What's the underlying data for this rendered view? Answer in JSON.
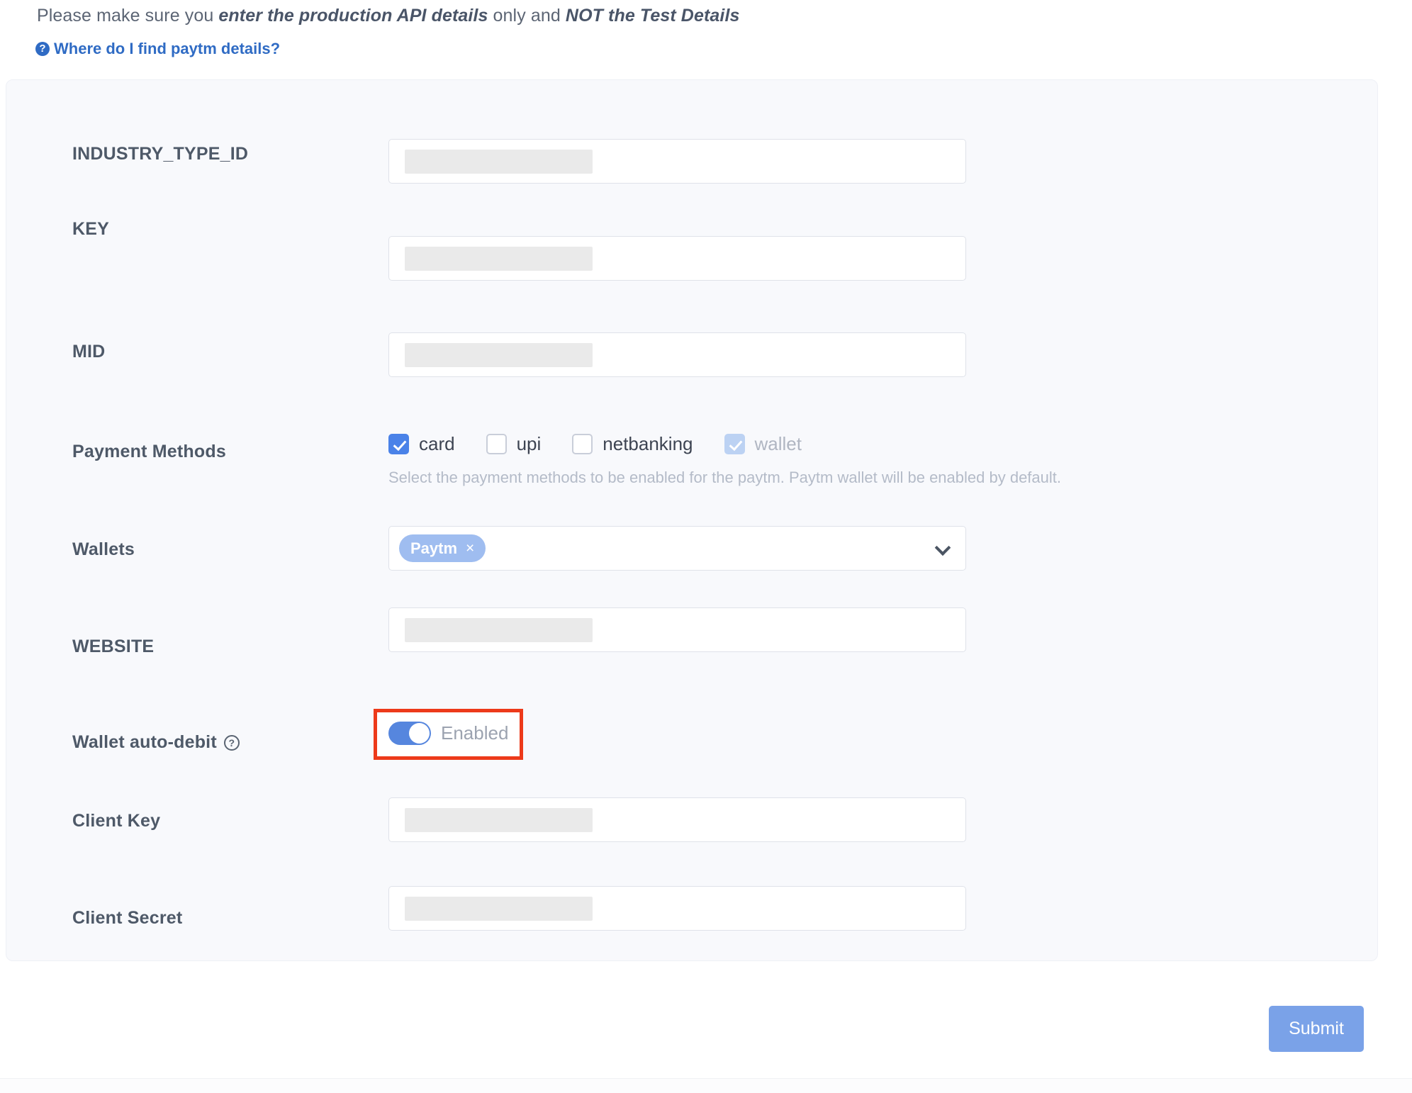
{
  "notice": {
    "part1": "Please make sure you ",
    "em1": "enter the production API details",
    "part2": " only and ",
    "em2": "NOT the Test Details"
  },
  "help_link": {
    "icon": "question-circle-icon",
    "label": "Where do I find paytm details?"
  },
  "form": {
    "fields": [
      {
        "label": "INDUSTRY_TYPE_ID",
        "value": "",
        "placeholder": ""
      },
      {
        "label": "KEY",
        "value": "",
        "placeholder": ""
      },
      {
        "label": "MID",
        "value": "",
        "placeholder": ""
      },
      {
        "label": "WEBSITE",
        "value": "",
        "placeholder": ""
      },
      {
        "label": "Client Key",
        "value": "",
        "placeholder": ""
      },
      {
        "label": "Client Secret",
        "value": "",
        "placeholder": ""
      }
    ],
    "payment_methods": {
      "label": "Payment Methods",
      "options": [
        {
          "label": "card",
          "checked": true,
          "disabled": false
        },
        {
          "label": "upi",
          "checked": false,
          "disabled": false
        },
        {
          "label": "netbanking",
          "checked": false,
          "disabled": false
        },
        {
          "label": "wallet",
          "checked": true,
          "disabled": true
        }
      ],
      "helper": "Select the payment methods to be enabled for the paytm. Paytm wallet will be enabled by default."
    },
    "wallets": {
      "label": "Wallets",
      "selected": [
        {
          "name": "Paytm",
          "remove": "×"
        }
      ],
      "chevron": "chevron-down-icon"
    },
    "wallet_auto_debit": {
      "label": "Wallet auto-debit",
      "info_icon": "question-circle-outline-icon",
      "state_label": "Enabled",
      "enabled": true,
      "highlighted": true
    },
    "submit_label": "Submit"
  },
  "colors": {
    "accent_blue": "#4a82e8",
    "link_blue": "#2f6bc4",
    "submit_blue": "#7aa2e8",
    "tag_blue": "#9fbdf0",
    "highlight_red": "#ed3a1a",
    "card_bg": "#f8f9fc"
  }
}
